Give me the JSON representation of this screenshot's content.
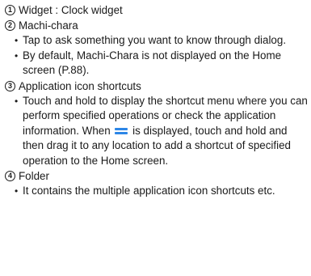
{
  "items": [
    {
      "number": "1",
      "title": "Widget : Clock widget",
      "bullets": []
    },
    {
      "number": "2",
      "title": "Machi-chara",
      "bullets": [
        "Tap to ask something you want to know through dialog.",
        "By default, Machi-Chara is not displayed on the Home screen (P.88)."
      ]
    },
    {
      "number": "3",
      "title": "Application icon shortcuts",
      "bullets": [
        {
          "before": "Touch and hold to display the shortcut menu where you can perform specified operations or check the application information. When",
          "icon": "drag-handle-icon",
          "after": "is displayed, touch and hold and then drag it to any location to add a shortcut of specified operation to the Home screen."
        }
      ]
    },
    {
      "number": "4",
      "title": "Folder",
      "bullets": [
        "It contains the multiple application icon shortcuts etc."
      ]
    }
  ],
  "colors": {
    "text": "#1a1a1a",
    "icon_blue": "#2d86e6"
  }
}
